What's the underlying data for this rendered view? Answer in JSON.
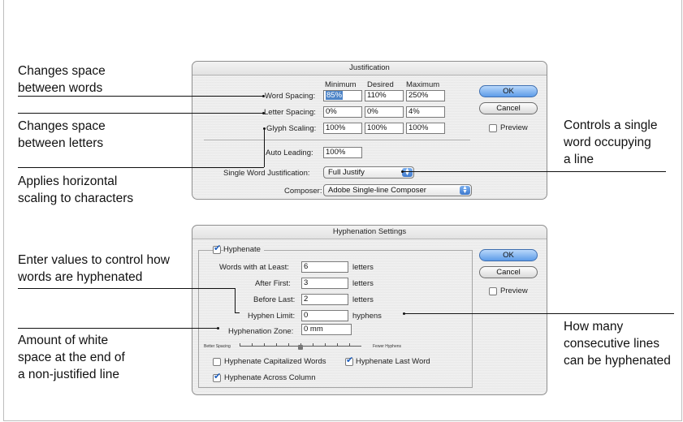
{
  "annotations": {
    "word_space": "Changes space\nbetween words",
    "letter_space": "Changes space\nbetween letters",
    "horiz_scaling": "Applies horizontal\nscaling to characters",
    "single_word": "Controls a single\nword occupying\na line",
    "hyphen_values": "Enter values to control how\nwords are hyphenated",
    "white_space": "Amount of white\nspace at the end of\na non-justified line",
    "consecutive": "How many\nconsecutive lines\ncan be hyphenated"
  },
  "justification": {
    "title": "Justification",
    "col_min": "Minimum",
    "col_desired": "Desired",
    "col_max": "Maximum",
    "word_spacing_label": "Word Spacing:",
    "word_spacing": [
      "85%",
      "110%",
      "250%"
    ],
    "letter_spacing_label": "Letter Spacing:",
    "letter_spacing": [
      "0%",
      "0%",
      "4%"
    ],
    "glyph_scaling_label": "Glyph Scaling:",
    "glyph_scaling": [
      "100%",
      "100%",
      "100%"
    ],
    "auto_leading_label": "Auto Leading:",
    "auto_leading": "100%",
    "single_word_label": "Single Word Justification:",
    "single_word_value": "Full Justify",
    "composer_label": "Composer:",
    "composer_value": "Adobe Single-line Composer",
    "ok": "OK",
    "cancel": "Cancel",
    "preview": "Preview"
  },
  "hyphenation": {
    "title": "Hyphenation Settings",
    "hyphenate": "Hyphenate",
    "words_label": "Words with at Least:",
    "words_value": "6",
    "after_first_label": "After First:",
    "after_first_value": "3",
    "before_last_label": "Before Last:",
    "before_last_value": "2",
    "limit_label": "Hyphen Limit:",
    "limit_value": "0",
    "zone_label": "Hyphenation Zone:",
    "zone_value": "0 mm",
    "unit_letters": "letters",
    "unit_hyphens": "hyphens",
    "slider_left": "Better Spacing",
    "slider_right": "Fewer Hyphens",
    "slider_position": 0.5,
    "cap_words": "Hyphenate Capitalized Words",
    "last_word": "Hyphenate Last Word",
    "across_column": "Hyphenate Across Column",
    "ok": "OK",
    "cancel": "Cancel",
    "preview": "Preview"
  }
}
